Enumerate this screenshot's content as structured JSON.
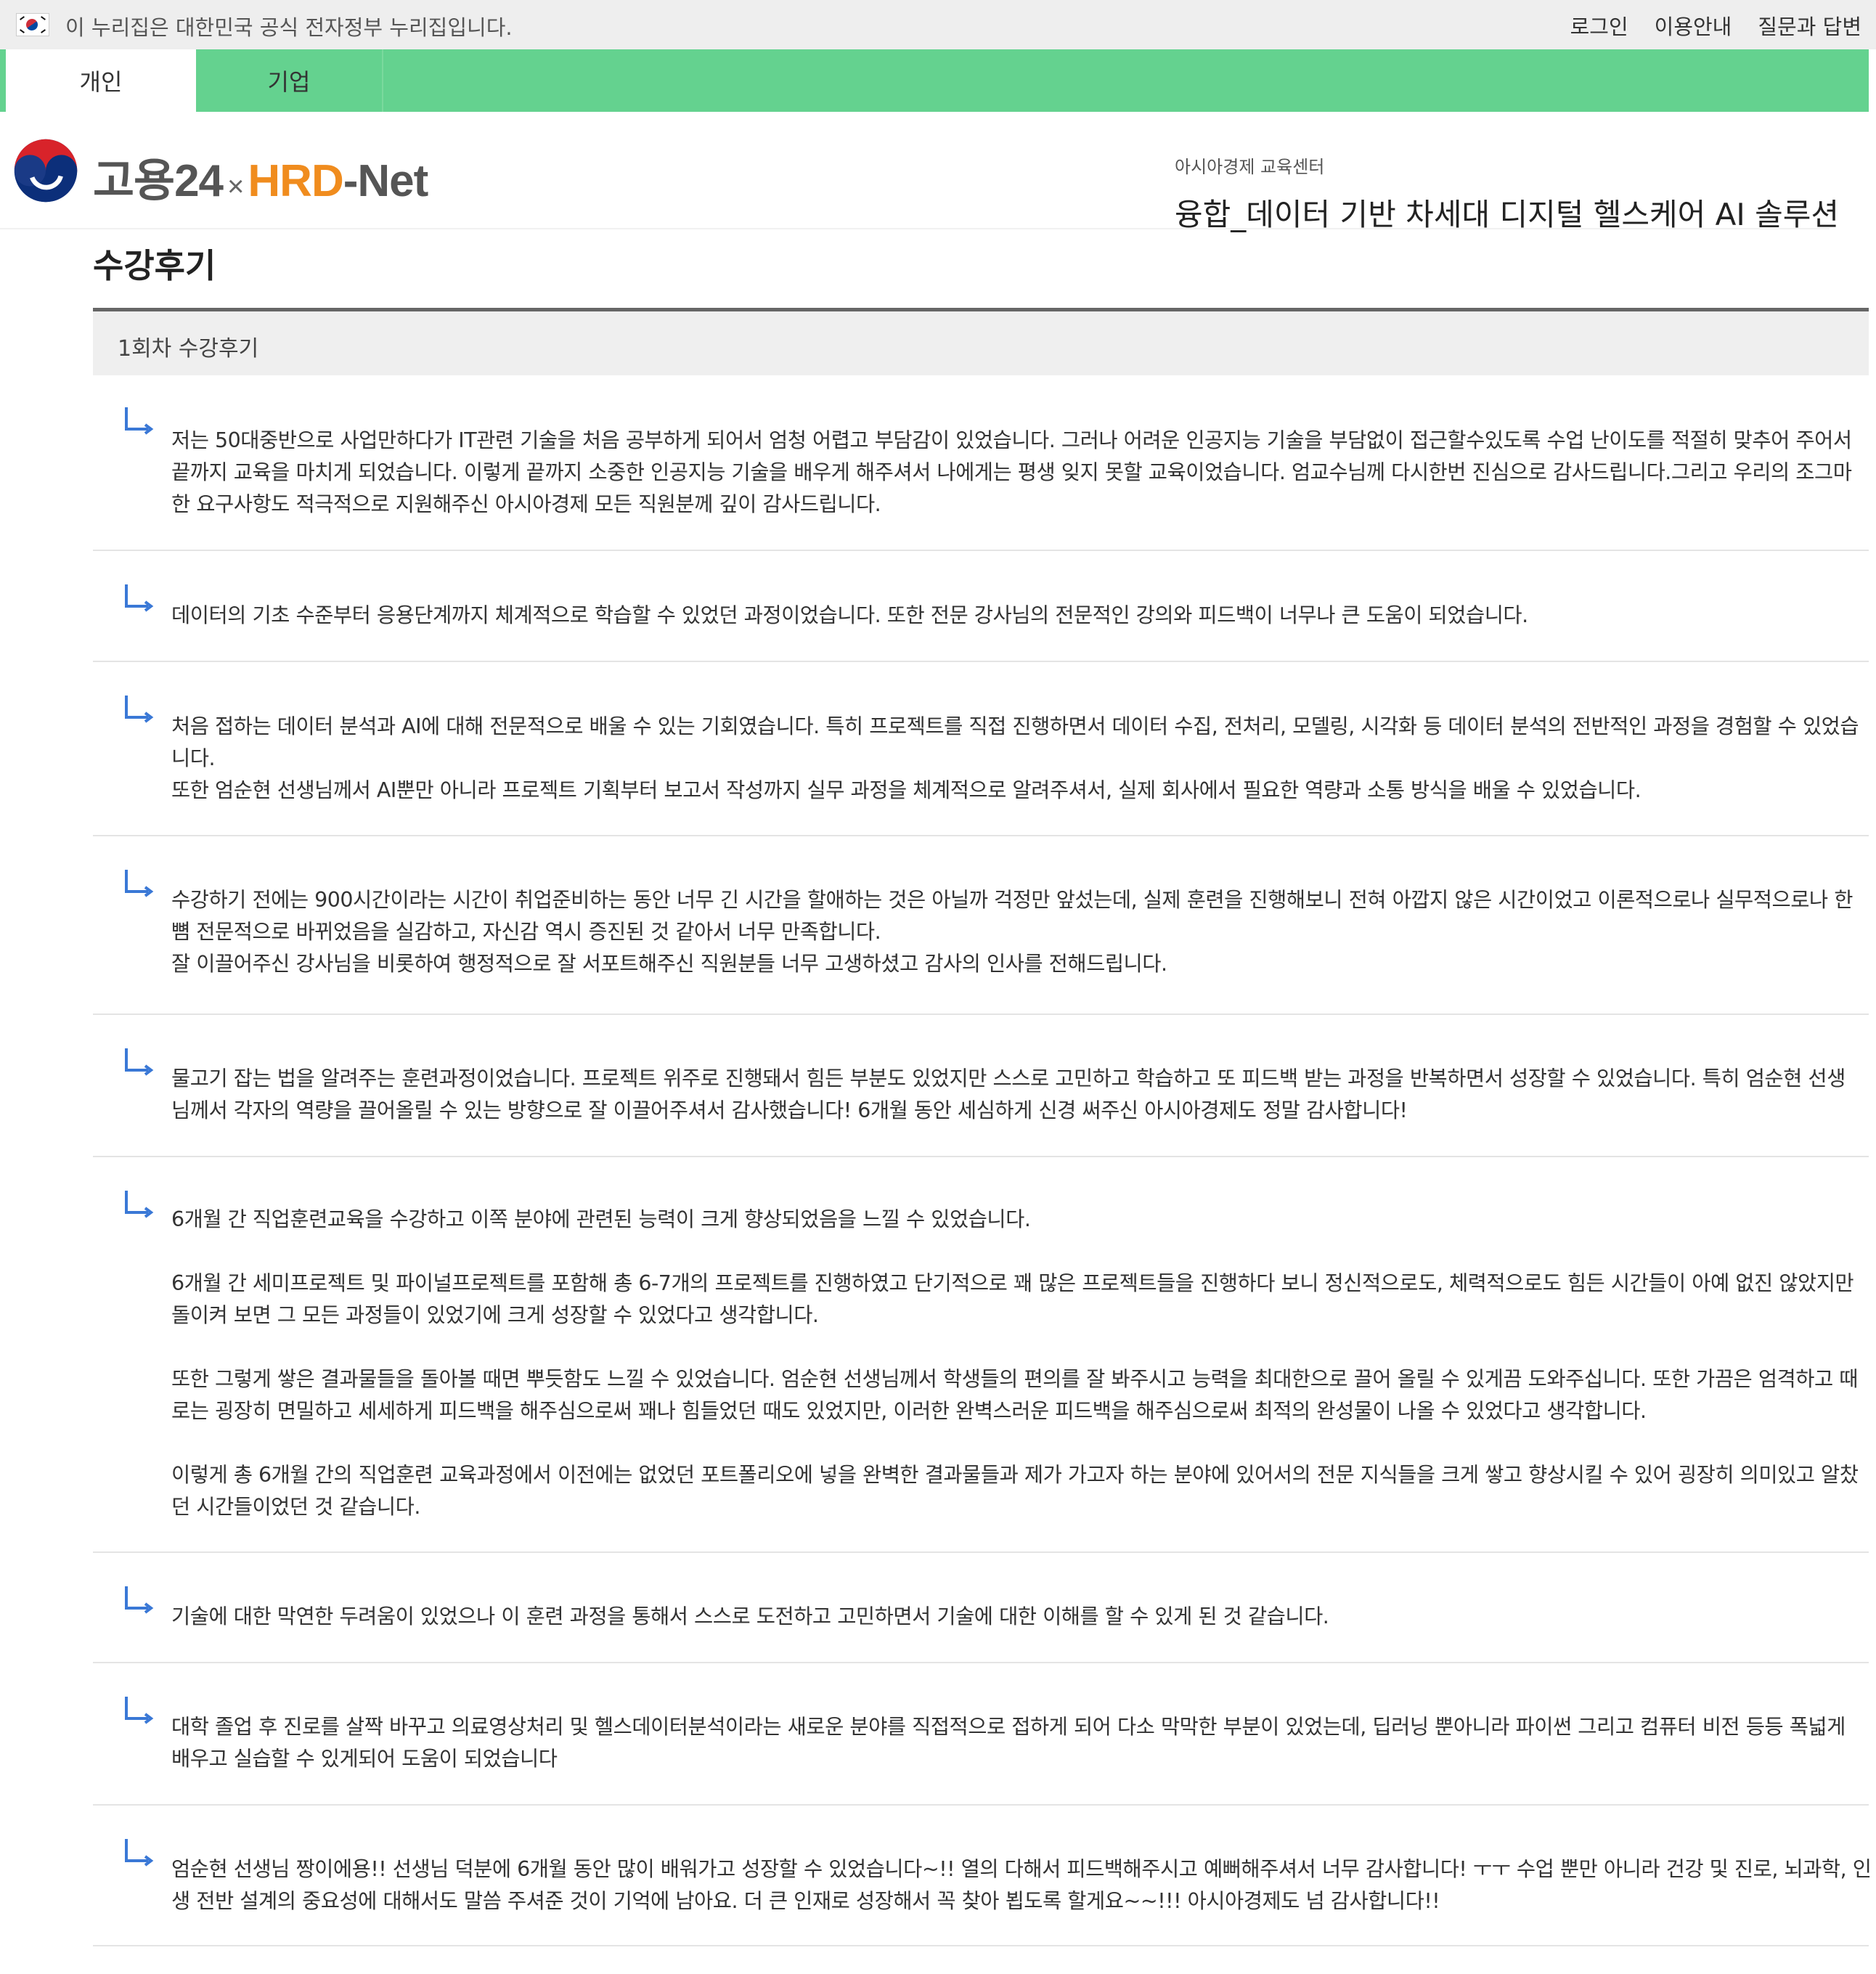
{
  "gov_banner": {
    "notice": "이 누리집은 대한민국 공식 전자정부 누리집입니다.",
    "links": [
      "로그인",
      "이용안내",
      "질문과 답변"
    ]
  },
  "tabs": [
    "개인",
    "기업"
  ],
  "logo": {
    "goyong": "고용24",
    "x": "×",
    "hrd": "HRD",
    "net": "-Net"
  },
  "course": {
    "institution": "아시아경제 교육센터",
    "title": "융합_데이터 기반 차세대 디지털 헬스케어 AI 솔루션"
  },
  "page_title": "수강후기",
  "section_title": "1회차 수강후기",
  "colors": {
    "tab_bar": "#64d28f",
    "arrow": "#3a78d6",
    "logo_orange": "#f08c1e"
  },
  "reviews": [
    {
      "text": "저는 50대중반으로 사업만하다가 IT관련 기술을 처음 공부하게 되어서 엄청 어렵고 부담감이 있었습니다. 그러나 어려운 인공지능 기술을 부담없이 접근할수있도록 수업 난이도를 적절히 맞추어 주어서\n끝까지 교육을 마치게 되었습니다. 이렇게 끝까지 소중한 인공지능 기술을 배우게 해주셔서 나에게는 평생 잊지 못할 교육이었습니다. 엄교수님께 다시한번 진심으로 감사드립니다.그리고 우리의 조그마\n한 요구사항도 적극적으로 지원해주신 아시아경제 모든 직원분께 깊이 감사드립니다."
    },
    {
      "text": " 데이터의 기초 수준부터 응용단계까지 체계적으로 학습할 수 있었던 과정이었습니다. 또한 전문 강사님의 전문적인 강의와 피드백이 너무나 큰 도움이 되었습니다."
    },
    {
      "text": "처음 접하는 데이터 분석과 AI에 대해 전문적으로 배울 수 있는 기회였습니다. 특히 프로젝트를 직접 진행하면서 데이터 수집, 전처리, 모델링, 시각화 등 데이터 분석의 전반적인 과정을 경험할 수 있었습\n니다.\n또한 엄순현 선생님께서 AI뿐만 아니라 프로젝트 기획부터 보고서 작성까지 실무 과정을 체계적으로 알려주셔서, 실제 회사에서 필요한 역량과 소통 방식을 배울 수 있었습니다."
    },
    {
      "text": "수강하기 전에는 900시간이라는 시간이 취업준비하는 동안 너무 긴 시간을 할애하는 것은 아닐까 걱정만 앞섰는데, 실제 훈련을 진행해보니 전혀 아깝지 않은 시간이었고 이론적으로나 실무적으로나 한\n뼘 전문적으로 바뀌었음을 실감하고, 자신감 역시 증진된 것 같아서 너무 만족합니다.\n잘 이끌어주신 강사님을 비롯하여 행정적으로 잘 서포트해주신 직원분들 너무 고생하셨고 감사의 인사를 전해드립니다."
    },
    {
      "text": "물고기 잡는 법을 알려주는 훈련과정이었습니다. 프로젝트 위주로 진행돼서 힘든 부분도 있었지만 스스로 고민하고 학습하고 또 피드백 받는 과정을 반복하면서 성장할 수 있었습니다. 특히 엄순현 선생\n님께서 각자의 역량을 끌어올릴 수 있는 방향으로 잘 이끌어주셔서 감사했습니다! 6개월 동안 세심하게 신경 써주신 아시아경제도 정말 감사합니다!"
    },
    {
      "text": "6개월 간 직업훈련교육을 수강하고 이쪽 분야에 관련된 능력이 크게 향상되었음을 느낄 수 있었습니다.\n\n6개월 간 세미프로젝트 및 파이널프로젝트를 포함해 총 6-7개의 프로젝트를 진행하였고 단기적으로 꽤 많은 프로젝트들을 진행하다 보니 정신적으로도, 체력적으로도 힘든 시간들이 아예 없진 않았지만\n돌이켜 보면 그 모든 과정들이 있었기에 크게 성장할 수 있었다고 생각합니다.\n\n또한 그렇게 쌓은 결과물들을 돌아볼 때면 뿌듯함도 느낄 수 있었습니다. 엄순현 선생님께서 학생들의 편의를 잘 봐주시고 능력을 최대한으로 끌어 올릴 수 있게끔 도와주십니다. 또한 가끔은 엄격하고 때\n로는 굉장히 면밀하고 세세하게 피드백을 해주심으로써 꽤나 힘들었던 때도 있었지만, 이러한 완벽스러운 피드백을 해주심으로써 최적의 완성물이 나올 수 있었다고 생각합니다.\n\n이렇게 총 6개월 간의 직업훈련 교육과정에서 이전에는 없었던 포트폴리오에 넣을 완벽한 결과물들과 제가 가고자 하는 분야에 있어서의 전문 지식들을 크게 쌓고 향상시킬 수 있어 굉장히 의미있고 알찼\n던 시간들이었던 것 같습니다."
    },
    {
      "text": "기술에 대한 막연한 두려움이 있었으나 이 훈련 과정을 통해서 스스로 도전하고 고민하면서 기술에 대한 이해를 할 수 있게 된 것 같습니다."
    },
    {
      "text": "대학 졸업 후 진로를 살짝 바꾸고 의료영상처리 및 헬스데이터분석이라는 새로운 분야를 직접적으로 접하게 되어 다소 막막한 부분이 있었는데, 딥러닝 뿐아니라 파이썬 그리고 컴퓨터 비전 등등 폭넓게\n배우고 실습할 수 있게되어 도움이 되었습니다"
    },
    {
      "text": "엄순현 선생님 짱이에용!! 선생님 덕분에 6개월 동안 많이 배워가고 성장할 수 있었습니다~!! 열의 다해서 피드백해주시고 예뻐해주셔서 너무 감사합니다! ㅜㅜ 수업 뿐만 아니라 건강 및 진로, 뇌과학, 인\n생 전반 설계의 중요성에 대해서도 말씀 주셔준 것이 기억에 남아요. 더 큰 인재로 성장해서 꼭 찾아 뵙도록 할게요~~!!! 아시아경제도 넘 감사합니다!!"
    }
  ]
}
